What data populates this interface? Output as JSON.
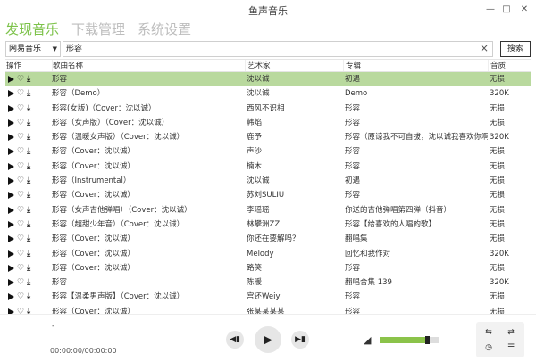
{
  "window": {
    "title": "鱼声音乐",
    "minimize_icon": "minimize-icon",
    "maximize_icon": "maximize-icon",
    "close_icon": "close-icon"
  },
  "nav": {
    "tabs": [
      {
        "label": "发现音乐",
        "active": true
      },
      {
        "label": "下载管理",
        "active": false
      },
      {
        "label": "系统设置",
        "active": false
      }
    ]
  },
  "search": {
    "source": "网易音乐",
    "query": "形容",
    "button": "搜索"
  },
  "table": {
    "headers": {
      "op": "操作",
      "name": "歌曲名称",
      "artist": "艺术家",
      "album": "专辑",
      "quality": "音质"
    },
    "rows": [
      {
        "name": "形容",
        "artist": "沈以诚",
        "album": "初遇",
        "quality": "无损",
        "selected": true
      },
      {
        "name": "形容（Demo）",
        "artist": "沈以诚",
        "album": "Demo",
        "quality": "320K"
      },
      {
        "name": "形容(女版)（Cover：沈以诚）",
        "artist": "西风不识相",
        "album": "形容",
        "quality": "无损"
      },
      {
        "name": "形容（女声版）（Cover：沈以诚）",
        "artist": "韩焰",
        "album": "形容",
        "quality": "无损"
      },
      {
        "name": "形容（温暖女声版）（Cover：沈以诚）",
        "artist": "鹿予",
        "album": "形容（原谅我不可自拔，沈以诚我喜欢你啊~",
        "quality": "320K"
      },
      {
        "name": "形容（Cover：沈以诚）",
        "artist": "声沙",
        "album": "形容",
        "quality": "无损"
      },
      {
        "name": "形容（Cover：沈以诚）",
        "artist": "楠木",
        "album": "形容",
        "quality": "无损"
      },
      {
        "name": "形容（Instrumental）",
        "artist": "沈以诚",
        "album": "初遇",
        "quality": "无损"
      },
      {
        "name": "形容（Cover：沈以诚）",
        "artist": "苏刘SULIU",
        "album": "形容",
        "quality": "无损"
      },
      {
        "name": "形容（女声吉他弹唱）（Cover：沈以诚）",
        "artist": "李瑶瑶",
        "album": "你送的吉他弹唱第四弹（抖音）",
        "quality": "无损"
      },
      {
        "name": "形容（超甜少年音）（Cover：沈以诚）",
        "artist": "林攀洲ZZ",
        "album": "形容【给喜欢的人唱的歌】",
        "quality": "无损"
      },
      {
        "name": "形容（Cover：沈以诚）",
        "artist": "你还在要解吗？",
        "album": "翻唱集",
        "quality": "无损"
      },
      {
        "name": "形容（Cover：沈以诚）",
        "artist": "Melody",
        "album": "回忆和我作对",
        "quality": "320K"
      },
      {
        "name": "形容（Cover：沈以诚）",
        "artist": "路笑",
        "album": "形容",
        "quality": "无损"
      },
      {
        "name": "形容",
        "artist": "陈暖",
        "album": "翻唱合集 139",
        "quality": "320K"
      },
      {
        "name": "形容【温柔男声版】（Cover：沈以诚）",
        "artist": "宫还Weiy",
        "album": "形容",
        "quality": "无损"
      },
      {
        "name": "形容（Cover：沈以诚）",
        "artist": "张某某某某",
        "album": "形容",
        "quality": "无损"
      }
    ]
  },
  "player": {
    "title": "-",
    "time": "00:00:00/00:00:00",
    "volume": 0.8,
    "prev_icon": "skip-previous-icon",
    "play_icon": "play-icon",
    "next_icon": "skip-next-icon",
    "volume_icon": "volume-icon",
    "tools": [
      "repeat-icon",
      "shuffle-icon",
      "alarm-icon",
      "equalizer-icon"
    ]
  }
}
